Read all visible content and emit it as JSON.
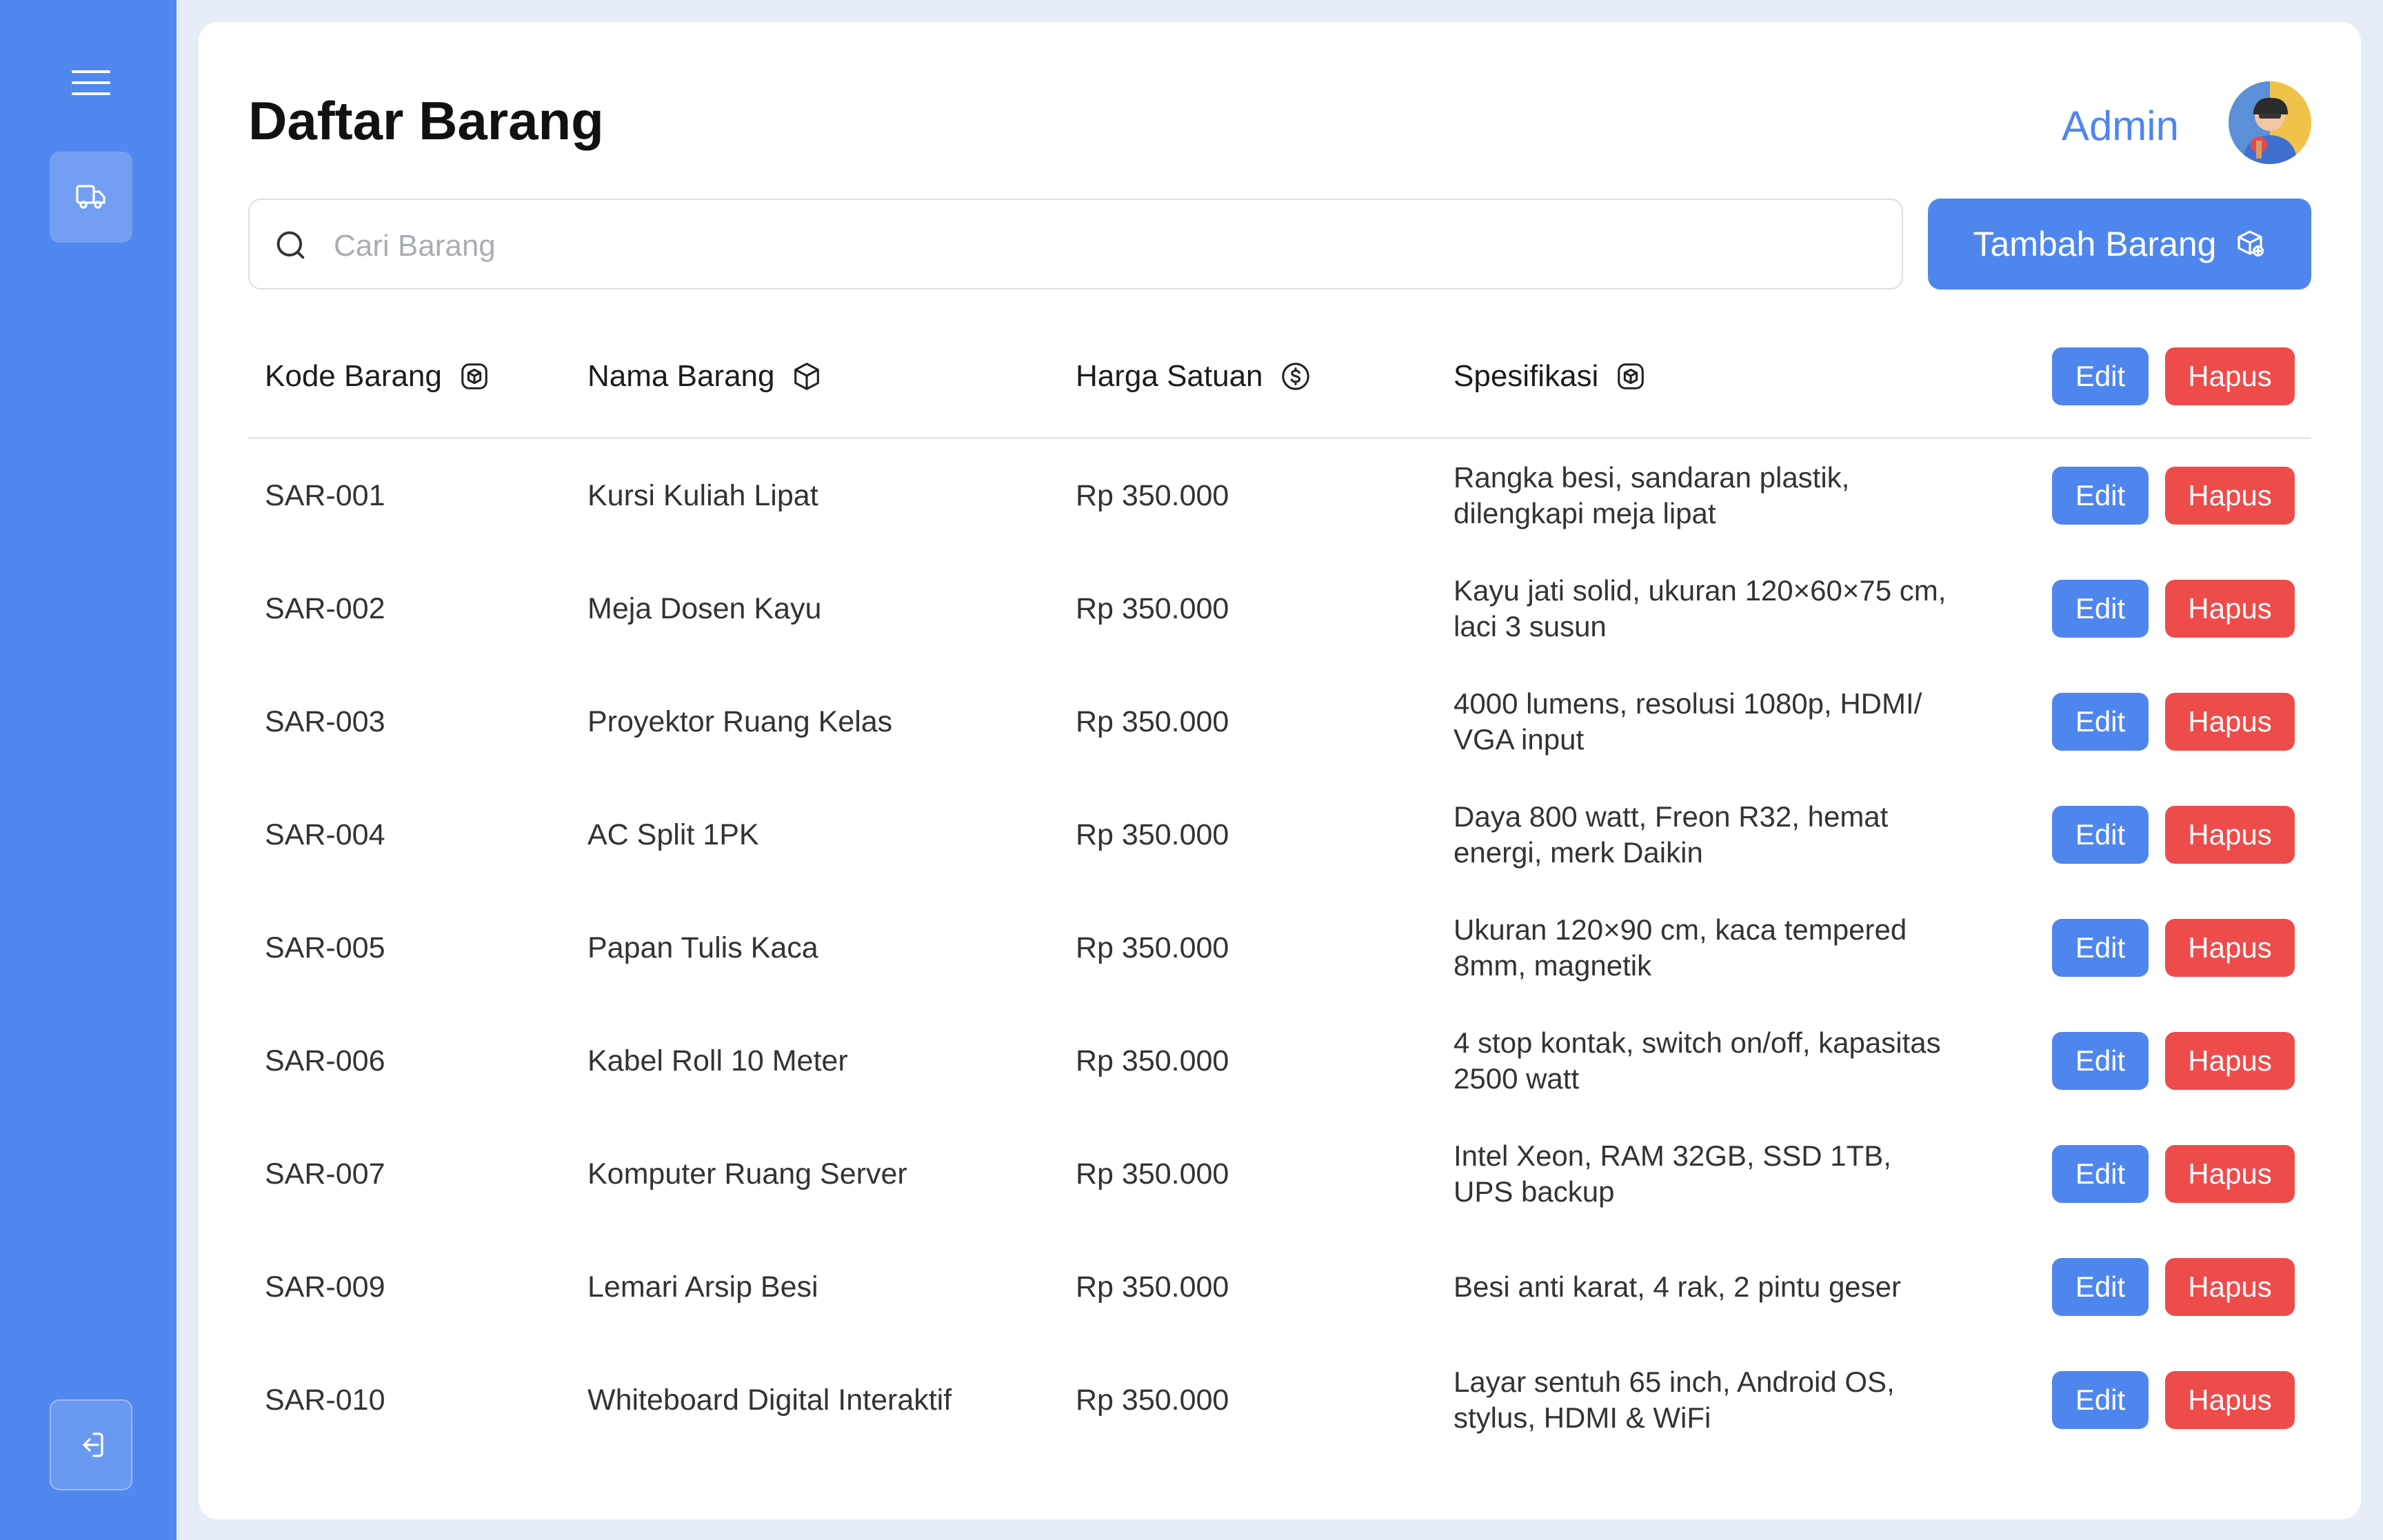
{
  "sidebar": {
    "menu_icon": "hamburger-icon",
    "nav_icon": "truck-icon",
    "logout_icon": "logout-icon"
  },
  "header": {
    "title": "Daftar Barang",
    "user_name": "Admin"
  },
  "search": {
    "placeholder": "Cari Barang"
  },
  "add_button": {
    "label": "Tambah Barang",
    "icon": "package-add-icon"
  },
  "table": {
    "columns": [
      {
        "label": "Kode Barang",
        "icon": "box-icon"
      },
      {
        "label": "Nama Barang",
        "icon": "cube-icon"
      },
      {
        "label": "Harga Satuan",
        "icon": "dollar-icon"
      },
      {
        "label": "Spesifikasi",
        "icon": "box-icon"
      }
    ],
    "header_actions": {
      "edit": "Edit",
      "delete": "Hapus"
    },
    "rows": [
      {
        "code": "SAR-001",
        "name": "Kursi Kuliah Lipat",
        "price": "Rp 350.000",
        "spec": "Rangka besi, sandaran plastik, dilengkapi meja lipat",
        "edit": "Edit",
        "delete": "Hapus"
      },
      {
        "code": "SAR-002",
        "name": "Meja Dosen Kayu",
        "price": "Rp 350.000",
        "spec": "Kayu jati solid, ukuran 120×60×75 cm, laci 3 susun",
        "edit": "Edit",
        "delete": "Hapus"
      },
      {
        "code": "SAR-003",
        "name": "Proyektor Ruang Kelas",
        "price": "Rp 350.000",
        "spec": "4000 lumens, resolusi 1080p, HDMI/ VGA input",
        "edit": "Edit",
        "delete": "Hapus"
      },
      {
        "code": "SAR-004",
        "name": "AC Split 1PK",
        "price": "Rp 350.000",
        "spec": "Daya 800 watt, Freon R32, hemat energi, merk Daikin",
        "edit": "Edit",
        "delete": "Hapus"
      },
      {
        "code": "SAR-005",
        "name": "Papan Tulis Kaca",
        "price": "Rp 350.000",
        "spec": "Ukuran 120×90 cm, kaca tempered 8mm, magnetik",
        "edit": "Edit",
        "delete": "Hapus"
      },
      {
        "code": "SAR-006",
        "name": "Kabel Roll 10 Meter",
        "price": "Rp 350.000",
        "spec": "4 stop kontak, switch on/off, kapasitas 2500 watt",
        "edit": "Edit",
        "delete": "Hapus"
      },
      {
        "code": "SAR-007",
        "name": "Komputer Ruang Server",
        "price": "Rp 350.000",
        "spec": "Intel Xeon, RAM 32GB, SSD 1TB, UPS backup",
        "edit": "Edit",
        "delete": "Hapus"
      },
      {
        "code": "SAR-009",
        "name": "Lemari Arsip Besi",
        "price": "Rp 350.000",
        "spec": "Besi anti karat, 4 rak, 2 pintu geser",
        "edit": "Edit",
        "delete": "Hapus"
      },
      {
        "code": "SAR-010",
        "name": "Whiteboard Digital Interaktif",
        "price": "Rp 350.000",
        "spec": "Layar sentuh 65 inch, Android OS, stylus, HDMI & WiFi",
        "edit": "Edit",
        "delete": "Hapus"
      }
    ]
  },
  "colors": {
    "primary": "#4f86ee",
    "sidebar": "#5088f0",
    "danger": "#ee4b4b",
    "background": "#e6edf9"
  }
}
